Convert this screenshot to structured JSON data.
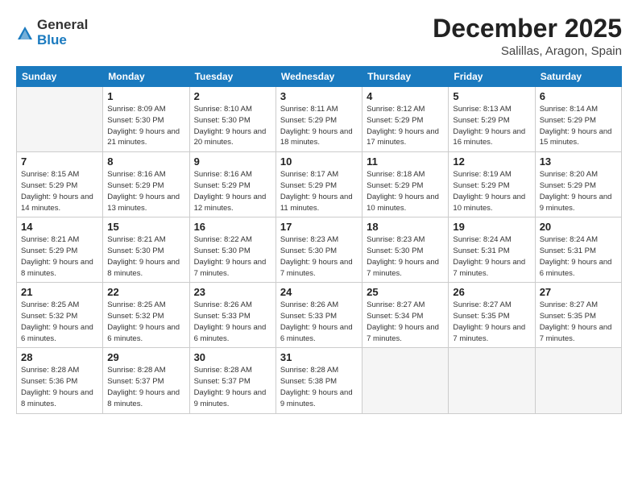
{
  "logo": {
    "general": "General",
    "blue": "Blue"
  },
  "header": {
    "month": "December 2025",
    "location": "Salillas, Aragon, Spain"
  },
  "days_of_week": [
    "Sunday",
    "Monday",
    "Tuesday",
    "Wednesday",
    "Thursday",
    "Friday",
    "Saturday"
  ],
  "weeks": [
    [
      {
        "day": "",
        "empty": true
      },
      {
        "day": "1",
        "sunrise": "Sunrise: 8:09 AM",
        "sunset": "Sunset: 5:30 PM",
        "daylight": "Daylight: 9 hours and 21 minutes."
      },
      {
        "day": "2",
        "sunrise": "Sunrise: 8:10 AM",
        "sunset": "Sunset: 5:30 PM",
        "daylight": "Daylight: 9 hours and 20 minutes."
      },
      {
        "day": "3",
        "sunrise": "Sunrise: 8:11 AM",
        "sunset": "Sunset: 5:29 PM",
        "daylight": "Daylight: 9 hours and 18 minutes."
      },
      {
        "day": "4",
        "sunrise": "Sunrise: 8:12 AM",
        "sunset": "Sunset: 5:29 PM",
        "daylight": "Daylight: 9 hours and 17 minutes."
      },
      {
        "day": "5",
        "sunrise": "Sunrise: 8:13 AM",
        "sunset": "Sunset: 5:29 PM",
        "daylight": "Daylight: 9 hours and 16 minutes."
      },
      {
        "day": "6",
        "sunrise": "Sunrise: 8:14 AM",
        "sunset": "Sunset: 5:29 PM",
        "daylight": "Daylight: 9 hours and 15 minutes."
      }
    ],
    [
      {
        "day": "7",
        "sunrise": "Sunrise: 8:15 AM",
        "sunset": "Sunset: 5:29 PM",
        "daylight": "Daylight: 9 hours and 14 minutes."
      },
      {
        "day": "8",
        "sunrise": "Sunrise: 8:16 AM",
        "sunset": "Sunset: 5:29 PM",
        "daylight": "Daylight: 9 hours and 13 minutes."
      },
      {
        "day": "9",
        "sunrise": "Sunrise: 8:16 AM",
        "sunset": "Sunset: 5:29 PM",
        "daylight": "Daylight: 9 hours and 12 minutes."
      },
      {
        "day": "10",
        "sunrise": "Sunrise: 8:17 AM",
        "sunset": "Sunset: 5:29 PM",
        "daylight": "Daylight: 9 hours and 11 minutes."
      },
      {
        "day": "11",
        "sunrise": "Sunrise: 8:18 AM",
        "sunset": "Sunset: 5:29 PM",
        "daylight": "Daylight: 9 hours and 10 minutes."
      },
      {
        "day": "12",
        "sunrise": "Sunrise: 8:19 AM",
        "sunset": "Sunset: 5:29 PM",
        "daylight": "Daylight: 9 hours and 10 minutes."
      },
      {
        "day": "13",
        "sunrise": "Sunrise: 8:20 AM",
        "sunset": "Sunset: 5:29 PM",
        "daylight": "Daylight: 9 hours and 9 minutes."
      }
    ],
    [
      {
        "day": "14",
        "sunrise": "Sunrise: 8:21 AM",
        "sunset": "Sunset: 5:29 PM",
        "daylight": "Daylight: 9 hours and 8 minutes."
      },
      {
        "day": "15",
        "sunrise": "Sunrise: 8:21 AM",
        "sunset": "Sunset: 5:30 PM",
        "daylight": "Daylight: 9 hours and 8 minutes."
      },
      {
        "day": "16",
        "sunrise": "Sunrise: 8:22 AM",
        "sunset": "Sunset: 5:30 PM",
        "daylight": "Daylight: 9 hours and 7 minutes."
      },
      {
        "day": "17",
        "sunrise": "Sunrise: 8:23 AM",
        "sunset": "Sunset: 5:30 PM",
        "daylight": "Daylight: 9 hours and 7 minutes."
      },
      {
        "day": "18",
        "sunrise": "Sunrise: 8:23 AM",
        "sunset": "Sunset: 5:30 PM",
        "daylight": "Daylight: 9 hours and 7 minutes."
      },
      {
        "day": "19",
        "sunrise": "Sunrise: 8:24 AM",
        "sunset": "Sunset: 5:31 PM",
        "daylight": "Daylight: 9 hours and 7 minutes."
      },
      {
        "day": "20",
        "sunrise": "Sunrise: 8:24 AM",
        "sunset": "Sunset: 5:31 PM",
        "daylight": "Daylight: 9 hours and 6 minutes."
      }
    ],
    [
      {
        "day": "21",
        "sunrise": "Sunrise: 8:25 AM",
        "sunset": "Sunset: 5:32 PM",
        "daylight": "Daylight: 9 hours and 6 minutes."
      },
      {
        "day": "22",
        "sunrise": "Sunrise: 8:25 AM",
        "sunset": "Sunset: 5:32 PM",
        "daylight": "Daylight: 9 hours and 6 minutes."
      },
      {
        "day": "23",
        "sunrise": "Sunrise: 8:26 AM",
        "sunset": "Sunset: 5:33 PM",
        "daylight": "Daylight: 9 hours and 6 minutes."
      },
      {
        "day": "24",
        "sunrise": "Sunrise: 8:26 AM",
        "sunset": "Sunset: 5:33 PM",
        "daylight": "Daylight: 9 hours and 6 minutes."
      },
      {
        "day": "25",
        "sunrise": "Sunrise: 8:27 AM",
        "sunset": "Sunset: 5:34 PM",
        "daylight": "Daylight: 9 hours and 7 minutes."
      },
      {
        "day": "26",
        "sunrise": "Sunrise: 8:27 AM",
        "sunset": "Sunset: 5:35 PM",
        "daylight": "Daylight: 9 hours and 7 minutes."
      },
      {
        "day": "27",
        "sunrise": "Sunrise: 8:27 AM",
        "sunset": "Sunset: 5:35 PM",
        "daylight": "Daylight: 9 hours and 7 minutes."
      }
    ],
    [
      {
        "day": "28",
        "sunrise": "Sunrise: 8:28 AM",
        "sunset": "Sunset: 5:36 PM",
        "daylight": "Daylight: 9 hours and 8 minutes."
      },
      {
        "day": "29",
        "sunrise": "Sunrise: 8:28 AM",
        "sunset": "Sunset: 5:37 PM",
        "daylight": "Daylight: 9 hours and 8 minutes."
      },
      {
        "day": "30",
        "sunrise": "Sunrise: 8:28 AM",
        "sunset": "Sunset: 5:37 PM",
        "daylight": "Daylight: 9 hours and 9 minutes."
      },
      {
        "day": "31",
        "sunrise": "Sunrise: 8:28 AM",
        "sunset": "Sunset: 5:38 PM",
        "daylight": "Daylight: 9 hours and 9 minutes."
      },
      {
        "day": "",
        "empty": true
      },
      {
        "day": "",
        "empty": true
      },
      {
        "day": "",
        "empty": true
      }
    ]
  ]
}
